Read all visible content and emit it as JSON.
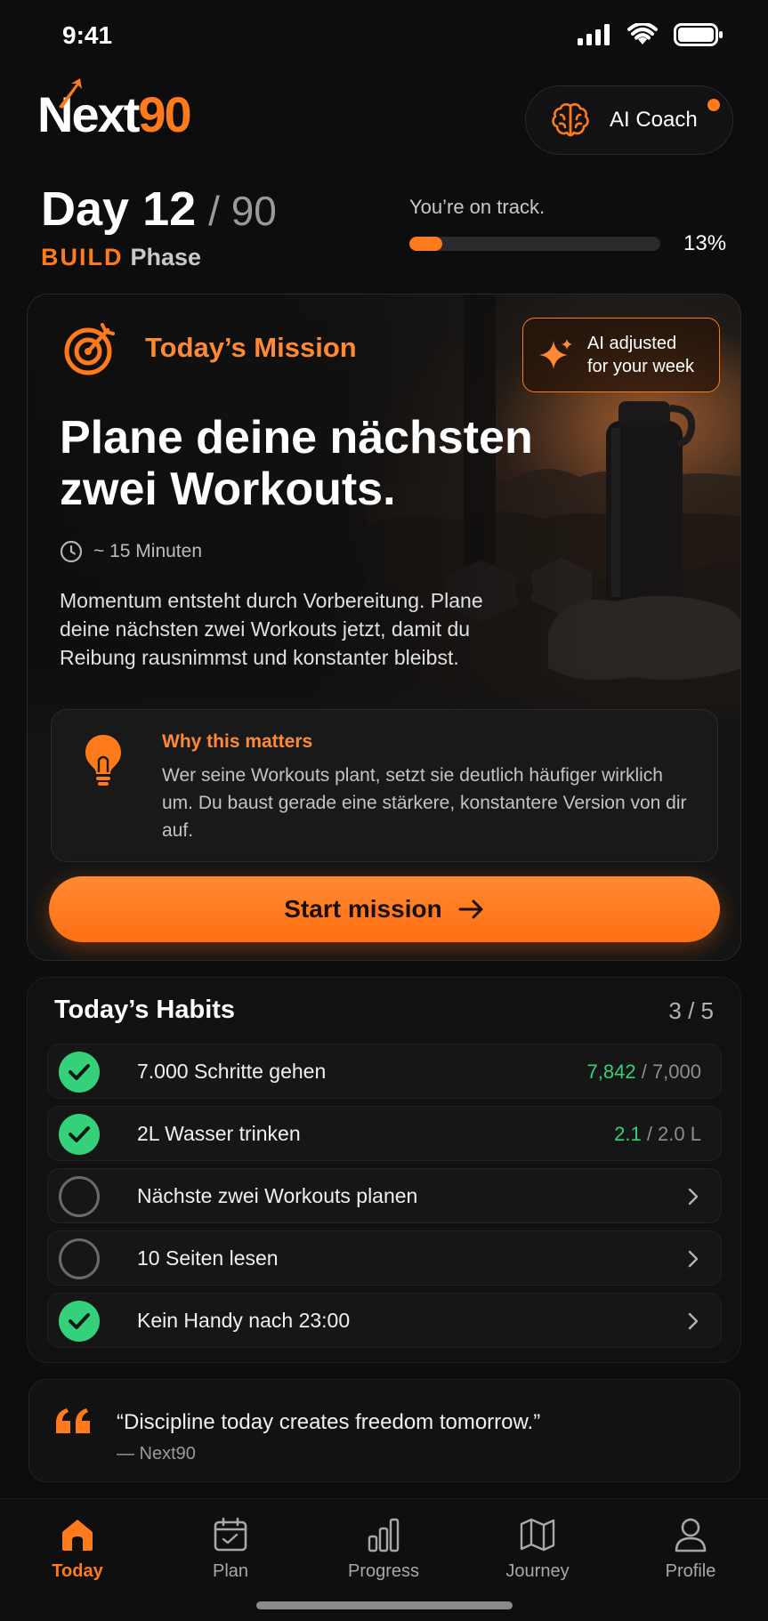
{
  "status_bar": {
    "time": "9:41"
  },
  "header": {
    "logo_text": "Next",
    "logo_num": "90",
    "coach_label": "AI Coach"
  },
  "progress": {
    "day_label": "Day 12",
    "day_total": "/ 90",
    "phase_key": "BUILD",
    "phase_word": "Phase",
    "track_text": "You’re on track.",
    "percent_label": "13%",
    "percent_value": 13
  },
  "mission": {
    "section_title": "Today’s Mission",
    "ai_badge_line1": "AI adjusted",
    "ai_badge_line2": "for your week",
    "headline_line1": "Plane deine nächsten",
    "headline_line2": "zwei Workouts.",
    "duration": "~ 15 Minuten",
    "description": "Momentum entsteht durch Vorbereitung. Plane deine nächsten zwei Workouts jetzt, damit du Reibung rausnimmst und konstanter bleibst.",
    "why_title": "Why this matters",
    "why_text": "Wer seine Workouts plant, setzt sie deutlich häufiger wirklich um. Du baust gerade eine stärkere, konstantere Version von dir auf.",
    "cta_label": "Start mission"
  },
  "habits": {
    "title": "Today’s Habits",
    "count": "3 / 5",
    "items": [
      {
        "label": "7.000 Schritte gehen",
        "done": true,
        "current": "7,842",
        "target": " / 7,000"
      },
      {
        "label": "2L Wasser trinken",
        "done": true,
        "current": "2.1",
        "target": " / 2.0 L"
      },
      {
        "label": "Nächste zwei Workouts planen",
        "done": false
      },
      {
        "label": "10 Seiten lesen",
        "done": false
      },
      {
        "label": "Kein Handy nach 23:00",
        "done": true
      }
    ]
  },
  "quote": {
    "text": "“Discipline today creates freedom tomorrow.”",
    "author": "— Next90"
  },
  "tabs": [
    {
      "label": "Today",
      "active": true
    },
    {
      "label": "Plan",
      "active": false
    },
    {
      "label": "Progress",
      "active": false
    },
    {
      "label": "Journey",
      "active": false
    },
    {
      "label": "Profile",
      "active": false
    }
  ],
  "colors": {
    "accent": "#ff7a1a",
    "success": "#35d07a",
    "background": "#0d0d0e"
  }
}
